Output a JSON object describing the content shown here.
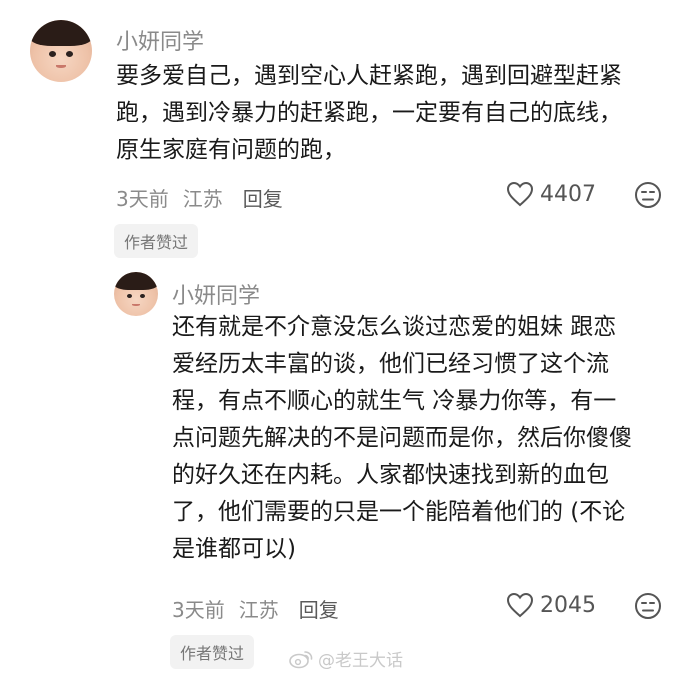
{
  "comments": [
    {
      "username": "小妍同学",
      "content": "要多爱自己，遇到空心人赶紧跑，遇到回避型赶紧\n跑，遇到冷暴力的赶紧跑，一定要有自己的底线，\n原生家庭有问题的跑，",
      "time": "3天前",
      "location": "江苏",
      "reply_label": "回复",
      "likes": "4407",
      "badge": "作者赞过"
    },
    {
      "username": "小妍同学",
      "content": "还有就是不介意没怎么谈过恋爱的姐妹 跟恋\n爱经历太丰富的谈，他们已经习惯了这个流\n程，有点不顺心的就生气 冷暴力你等，有一\n点问题先解决的不是问题而是你，然后你傻傻\n的好久还在内耗。人家都快速找到新的血包\n了，他们需要的只是一个能陪着他们的 (不论\n是谁都可以)",
      "time": "3天前",
      "location": "江苏",
      "reply_label": "回复",
      "likes": "2045",
      "badge": "作者赞过"
    }
  ],
  "watermark": "@老王大话",
  "icons": {
    "like": "heart-outline-icon",
    "dislike": "neutral-face-icon",
    "watermark_logo": "weibo-logo-icon"
  }
}
